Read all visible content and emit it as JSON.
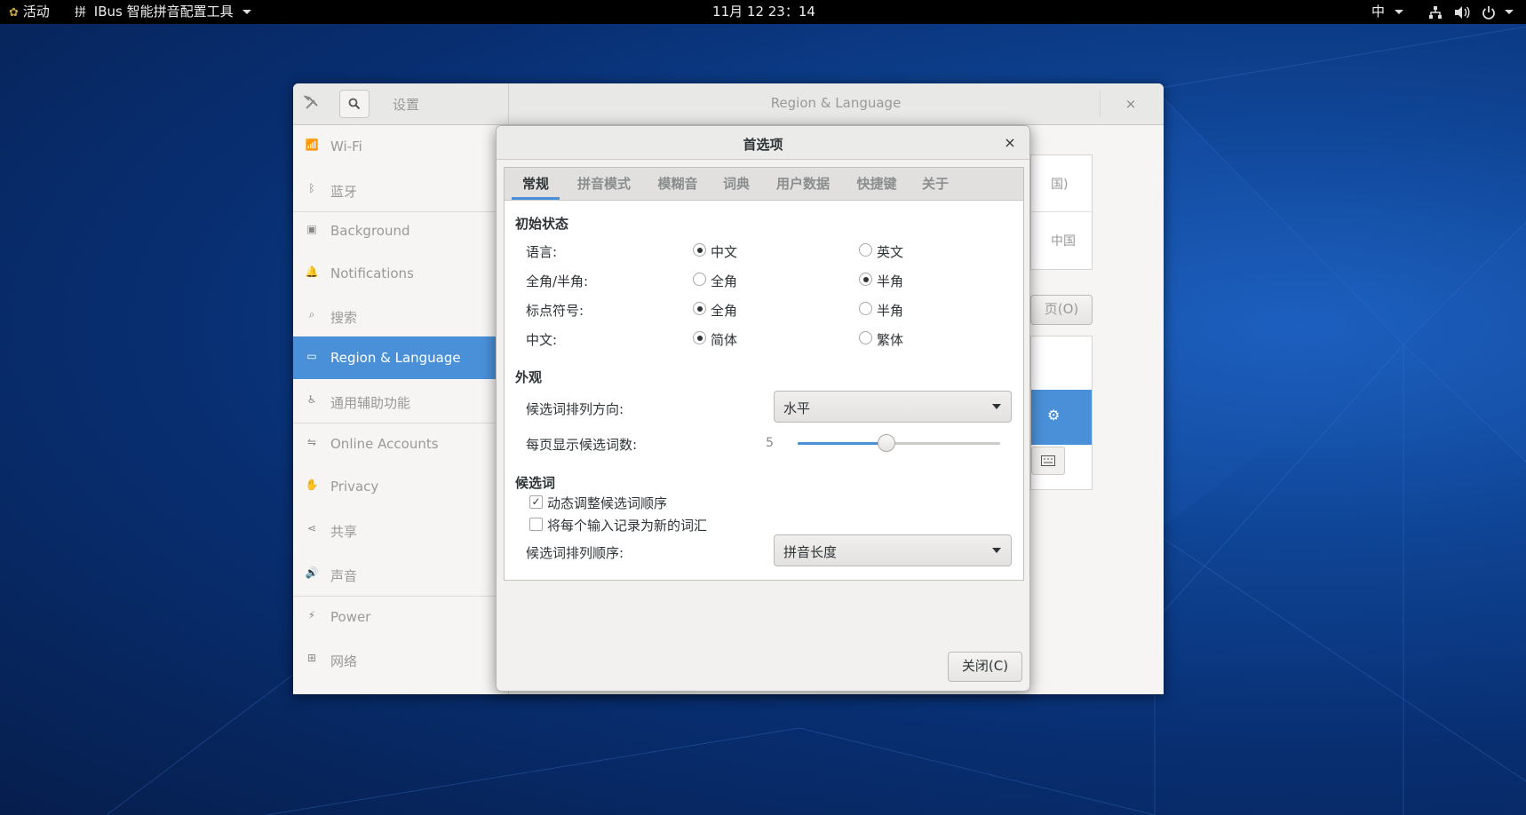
{
  "topbar": {
    "activities": "活动",
    "app_name": "IBus 智能拼音配置工具",
    "app_icon": "拼",
    "clock": "11月 12  23：14",
    "input_method": "中",
    "status_icons": [
      "network-icon",
      "volume-icon",
      "power-icon"
    ]
  },
  "settings": {
    "search_placeholder": "设置",
    "panel_title": "Region & Language",
    "close_glyph": "×",
    "sidebar": [
      {
        "label": "Wi-Fi",
        "icon": "wifi-icon"
      },
      {
        "label": "蓝牙",
        "icon": "bluetooth-icon"
      },
      {
        "label": "Background",
        "icon": "background-icon"
      },
      {
        "label": "Notifications",
        "icon": "bell-icon"
      },
      {
        "label": "搜索",
        "icon": "search-icon"
      },
      {
        "label": "Region & Language",
        "icon": "region-icon",
        "active": true
      },
      {
        "label": "通用辅助功能",
        "icon": "accessibility-icon"
      },
      {
        "label": "Online Accounts",
        "icon": "online-accounts-icon"
      },
      {
        "label": "Privacy",
        "icon": "hand-icon"
      },
      {
        "label": "共享",
        "icon": "share-icon"
      },
      {
        "label": "声音",
        "icon": "speaker-icon"
      },
      {
        "label": "Power",
        "icon": "power-icon"
      },
      {
        "label": "网络",
        "icon": "network-icon"
      }
    ],
    "behind_fragments": {
      "frag1": "国)",
      "frag2": "中国",
      "frag3": "页(O)"
    }
  },
  "dialog": {
    "title": "首选项",
    "close_glyph": "×",
    "tabs": [
      "常规",
      "拼音模式",
      "模糊音",
      "词典",
      "用户数据",
      "快捷键",
      "关于"
    ],
    "active_tab": "常规",
    "initial_state": {
      "heading": "初始状态",
      "rows": [
        {
          "label": "语言:",
          "opt1": "中文",
          "opt2": "英文",
          "selected": 1
        },
        {
          "label": "全角/半角:",
          "opt1": "全角",
          "opt2": "半角",
          "selected": 2
        },
        {
          "label": "标点符号:",
          "opt1": "全角",
          "opt2": "半角",
          "selected": 1
        },
        {
          "label": "中文:",
          "opt1": "简体",
          "opt2": "繁体",
          "selected": 1
        }
      ]
    },
    "appearance": {
      "heading": "外观",
      "orientation_label": "候选词排列方向:",
      "orientation_value": "水平",
      "page_size_label": "每页显示候选词数:",
      "page_size_value": "5",
      "page_size_fraction": 0.44
    },
    "candidates": {
      "heading": "候选词",
      "dynamic_adjust_label": "动态调整候选词顺序",
      "dynamic_adjust_checked": true,
      "record_new_label": "将每个输入记录为新的词汇",
      "record_new_checked": false,
      "sort_label": "候选词排列顺序:",
      "sort_value": "拼音长度"
    },
    "close_button": "关闭(C)"
  }
}
